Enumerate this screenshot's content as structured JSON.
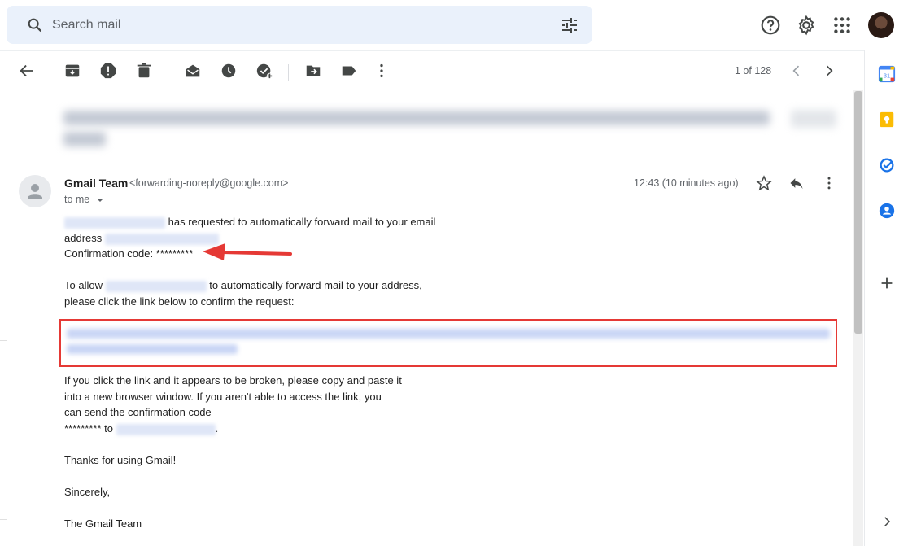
{
  "search": {
    "placeholder": "Search mail"
  },
  "icons": {
    "search": "search-icon",
    "tune": "tune-icon",
    "help": "help-icon",
    "settings": "gear-icon",
    "apps": "apps-grid-icon",
    "back": "back-arrow-icon",
    "archive": "archive-icon",
    "spam": "report-spam-icon",
    "delete": "trash-icon",
    "mark_unread": "mark-unread-icon",
    "snooze": "clock-icon",
    "add_task": "add-task-icon",
    "move": "move-to-icon",
    "label": "label-icon",
    "more": "more-vert-icon",
    "prev": "chevron-left-icon",
    "next": "chevron-right-icon",
    "star": "star-icon",
    "reply": "reply-icon",
    "calendar": "calendar-icon",
    "keep": "keep-icon",
    "tasks": "tasks-icon",
    "contacts": "contacts-icon",
    "add": "plus-icon",
    "expand": "chevron-right-icon"
  },
  "pager": {
    "label": "1 of 128"
  },
  "message": {
    "sender_name": "Gmail Team",
    "sender_email": "<forwarding-noreply@google.com>",
    "to": "to me",
    "time": "12:43 (10 minutes ago)",
    "body": {
      "l1": "has requested to automatically forward mail to your email",
      "l2": "address",
      "l3": "Confirmation code: *********",
      "l4a": "To allow",
      "l4b": "to automatically forward mail to your address,",
      "l5": "please click the link below to confirm the request:",
      "p1": "If you click the link and it appears to be broken, please copy and paste it",
      "p2": "into a new browser window. If you aren't able to access the link, you",
      "p3": "can send the confirmation code",
      "p4a": "********* to",
      "p4b": ".",
      "thanks": "Thanks for using Gmail!",
      "sincerely": "Sincerely,",
      "sign": "The Gmail Team"
    }
  },
  "colors": {
    "accent_red": "#e53935",
    "search_bg": "#eaf1fb",
    "blur_link": "#c9d5f5"
  }
}
